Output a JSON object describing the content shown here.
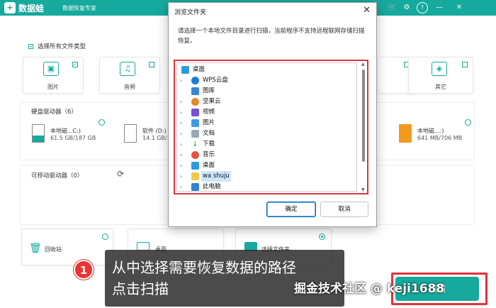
{
  "app": {
    "logo_glyph": "+",
    "name": "数据蛙",
    "subtitle": "数据恢复专家",
    "accent": "#16a99d"
  },
  "topbar_icons": [
    {
      "name": "cart-icon",
      "glyph": "🛒"
    },
    {
      "name": "settings-icon",
      "glyph": "⚙"
    },
    {
      "name": "help-icon",
      "glyph": "?"
    },
    {
      "name": "minimize-icon",
      "glyph": "—"
    },
    {
      "name": "close-icon",
      "glyph": "✕"
    }
  ],
  "main": {
    "select_all_label": "选择所有文件类型",
    "file_types": [
      {
        "label": "图片",
        "icon": "image-icon",
        "glyph": "▣",
        "checked": true
      },
      {
        "label": "音频",
        "icon": "music-icon",
        "glyph": "♫",
        "checked": false
      },
      {
        "label": "其它",
        "icon": "other-icon",
        "glyph": "◈",
        "checked": false
      }
    ],
    "hard_disk_title": "硬盘驱动器（6）",
    "drives": [
      {
        "name": "本地磁...C:)",
        "size": "61.5 GB/187 GB"
      },
      {
        "name": "软件 (D:)",
        "size": "14.1 GB/...GB"
      },
      {
        "name": "本地磁...:)",
        "size": "641 MB/706 MB"
      }
    ],
    "removable_title": "可移动驱动器（0）",
    "locations": [
      {
        "label": "回收站"
      },
      {
        "label": "桌面"
      },
      {
        "label": "选择文件夹"
      }
    ]
  },
  "dialog": {
    "title": "浏览文件夹",
    "close_glyph": "✕",
    "instruction": "请选择一个本地文件目录进行扫描，当前程序不支持远程联网存储扫描恢复。",
    "tree": [
      {
        "label": "桌面",
        "icon": "desktop-icon",
        "depth": 0,
        "expand": false,
        "selected": false
      },
      {
        "label": "WPS云盘",
        "icon": "cloud-icon",
        "depth": 1,
        "expand": true,
        "selected": false
      },
      {
        "label": "图库",
        "icon": "gallery-icon",
        "depth": 1,
        "expand": false,
        "selected": false
      },
      {
        "label": "坚果云",
        "icon": "nut-cloud-icon",
        "depth": 1,
        "expand": true,
        "selected": false
      },
      {
        "label": "视频",
        "icon": "video-icon",
        "depth": 1,
        "expand": true,
        "selected": false
      },
      {
        "label": "图片",
        "icon": "pictures-icon",
        "depth": 1,
        "expand": true,
        "selected": false
      },
      {
        "label": "文档",
        "icon": "documents-icon",
        "depth": 1,
        "expand": true,
        "selected": false
      },
      {
        "label": "下载",
        "icon": "downloads-icon",
        "depth": 1,
        "expand": true,
        "selected": false
      },
      {
        "label": "音乐",
        "icon": "music-folder-icon",
        "depth": 1,
        "expand": true,
        "selected": false
      },
      {
        "label": "桌面",
        "icon": "desktop-icon",
        "depth": 1,
        "expand": true,
        "selected": false
      },
      {
        "label": "wa shuju",
        "icon": "folder-icon",
        "depth": 1,
        "expand": true,
        "selected": true
      },
      {
        "label": "此电脑",
        "icon": "computer-icon",
        "depth": 1,
        "expand": true,
        "selected": false
      }
    ],
    "ok_label": "确定",
    "cancel_label": "取消"
  },
  "callout": {
    "step": "1",
    "line1": "从中选择需要恢复数据的路径",
    "line2": "点击扫描"
  },
  "scan_label": "扫描",
  "watermark": "掘金技术社区 @ keji1688",
  "colors": {
    "highlight_red": "#e0333a",
    "selection_blue": "#cce6ff"
  }
}
